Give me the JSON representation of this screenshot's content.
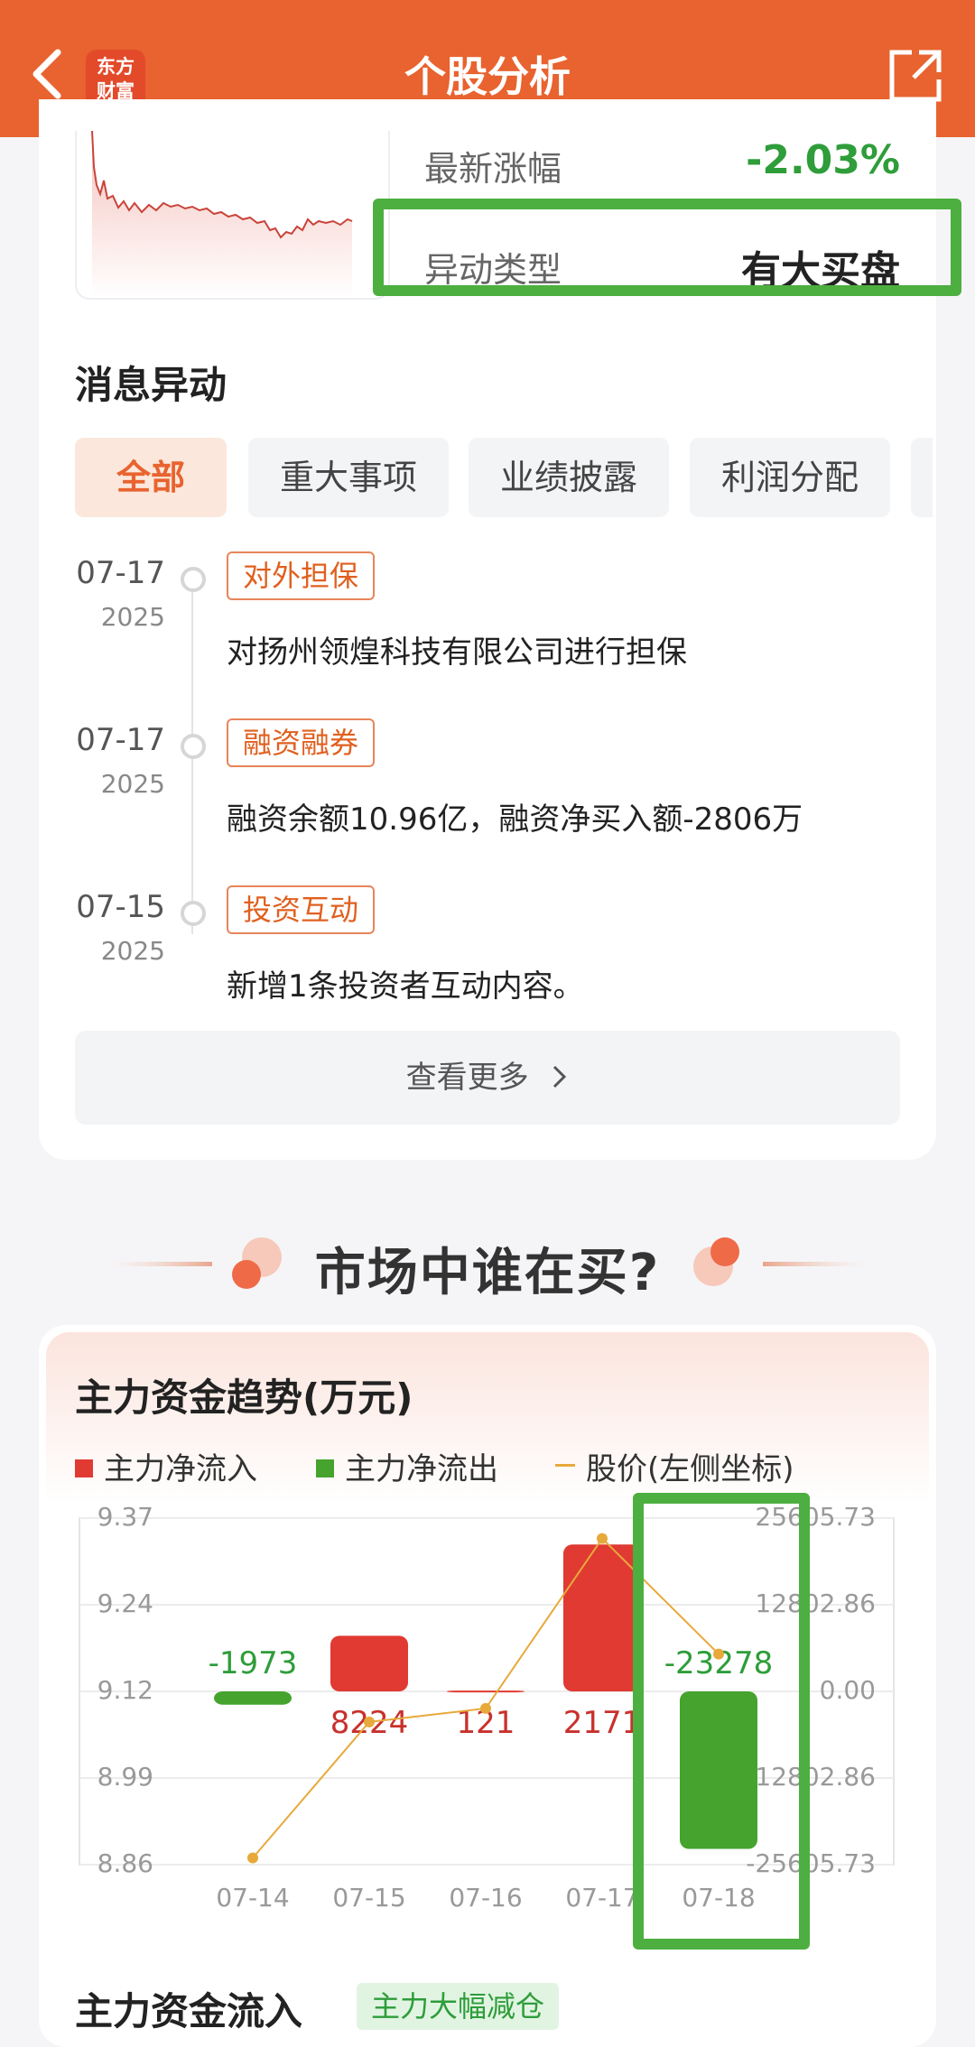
{
  "header": {
    "title": "个股分析",
    "logo_line1": "东方",
    "logo_line2": "财富"
  },
  "summary": {
    "latest_change_label": "最新涨幅",
    "latest_change_value": "-2.03%",
    "anomaly_type_label": "异动类型",
    "anomaly_type_value": "有大买盘"
  },
  "news": {
    "title": "消息异动",
    "tabs": [
      "全部",
      "重大事项",
      "业绩披露",
      "利润分配"
    ],
    "items": [
      {
        "date": "07-17",
        "year": "2025",
        "tag": "对外担保",
        "text": "对扬州领煌科技有限公司进行担保"
      },
      {
        "date": "07-17",
        "year": "2025",
        "tag": "融资融券",
        "text": "融资余额10.96亿，融资净买入额-2806万"
      },
      {
        "date": "07-15",
        "year": "2025",
        "tag": "投资互动",
        "text": "新增1条投资者互动内容。"
      }
    ],
    "more_label": "查看更多"
  },
  "banner": {
    "title": "市场中谁在买?"
  },
  "capital": {
    "title": "主力资金趋势(万元)",
    "legend": {
      "inflow": "主力净流入",
      "outflow": "主力净流出",
      "price": "股价(左侧坐标)"
    },
    "colors": {
      "inflow": "#e03a32",
      "outflow": "#45a32e",
      "price": "#e8a93b"
    }
  },
  "chart_data": {
    "type": "bar",
    "categories": [
      "07-14",
      "07-15",
      "07-16",
      "07-17",
      "07-18"
    ],
    "series": [
      {
        "name": "主力净流入",
        "values": [
          -1973,
          8224,
          121,
          21710,
          -23278
        ]
      },
      {
        "name": "股价(左侧坐标)",
        "values": [
          8.87,
          9.07,
          9.09,
          9.34,
          9.17
        ]
      }
    ],
    "data_labels": [
      "-1973",
      "8224",
      "121",
      "2171",
      "-23278"
    ],
    "left_ticks": [
      "9.37",
      "9.24",
      "9.12",
      "8.99",
      "8.86"
    ],
    "right_ticks": [
      "25605.73",
      "12802.86",
      "0.00",
      "-12802.86",
      "-25605.73"
    ],
    "left_range": [
      8.86,
      9.37
    ],
    "right_range": [
      -25605.73,
      25605.73
    ]
  },
  "flow": {
    "title": "主力资金流入",
    "badge": "主力大幅减仓"
  }
}
